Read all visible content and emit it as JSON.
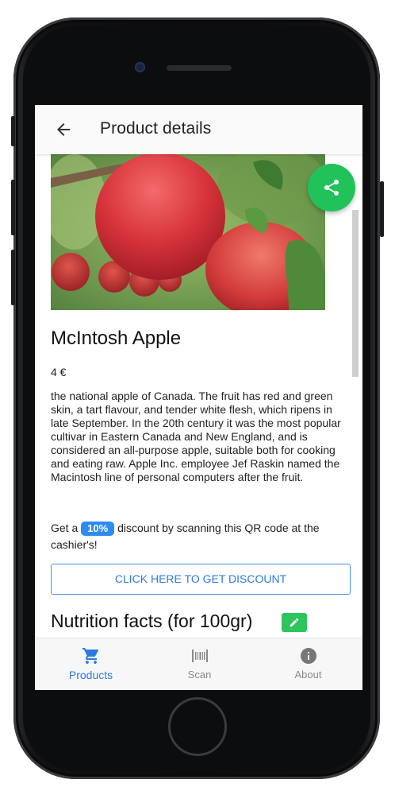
{
  "appbar": {
    "title": "Product details"
  },
  "product": {
    "name": "McIntosh Apple",
    "price": "4 €",
    "description": "the national apple of Canada. The fruit has red and green skin, a tart flavour, and tender white flesh, which ripens in late September. In the 20th century it was the most popular cultivar in Eastern Canada and New England, and is considered an all-purpose apple, suitable both for cooking and eating raw. Apple Inc. employee Jef Raskin named the Macintosh line of personal computers after the fruit."
  },
  "discount": {
    "prefix": "Get a",
    "badge": "10%",
    "suffix": "discount by scanning this QR code at the cashier's!",
    "button_label": "CLICK HERE TO GET DISCOUNT"
  },
  "nutrition": {
    "title": "Nutrition facts (for 100gr)"
  },
  "bottom_nav": {
    "items": [
      {
        "label": "Products",
        "icon": "cart-icon",
        "active": true
      },
      {
        "label": "Scan",
        "icon": "barcode-icon",
        "active": false
      },
      {
        "label": "About",
        "icon": "info-icon",
        "active": false
      }
    ]
  },
  "colors": {
    "accent": "#2d7be0",
    "share_fab": "#21c25a",
    "edit_icon": "#2ec45e",
    "inactive_nav": "#8a8a8a"
  }
}
